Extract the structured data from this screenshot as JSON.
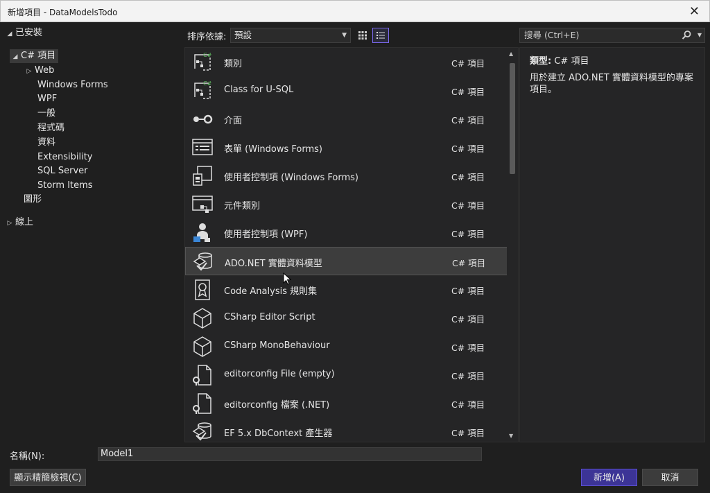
{
  "window": {
    "title": "新增項目 - DataModelsTodo"
  },
  "tree": {
    "installed": "已安裝",
    "csharp": "C# 項目",
    "children": [
      "Web",
      "Windows Forms",
      "WPF",
      "一般",
      "程式碼",
      "資料",
      "Extensibility",
      "SQL Server",
      "Storm Items"
    ],
    "graphics": "圖形",
    "online": "線上"
  },
  "toolbar": {
    "sort_label": "排序依據:",
    "sort_value": "預設"
  },
  "search": {
    "placeholder": "搜尋 (Ctrl+E)"
  },
  "items": [
    {
      "name": "類別",
      "lang": "C# 項目",
      "icon": "class-icon"
    },
    {
      "name": "Class for U-SQL",
      "lang": "C# 項目",
      "icon": "class-icon"
    },
    {
      "name": "介面",
      "lang": "C# 項目",
      "icon": "interface-icon"
    },
    {
      "name": "表單 (Windows Forms)",
      "lang": "C# 項目",
      "icon": "form-icon"
    },
    {
      "name": "使用者控制項 (Windows Forms)",
      "lang": "C# 項目",
      "icon": "user-control-icon"
    },
    {
      "name": "元件類別",
      "lang": "C# 項目",
      "icon": "component-icon"
    },
    {
      "name": "使用者控制項 (WPF)",
      "lang": "C# 項目",
      "icon": "wpf-user-control-icon"
    },
    {
      "name": "ADO.NET 實體資料模型",
      "lang": "C# 項目",
      "icon": "entity-model-icon"
    },
    {
      "name": "Code Analysis 規則集",
      "lang": "C# 項目",
      "icon": "ruleset-icon"
    },
    {
      "name": "CSharp Editor Script",
      "lang": "C# 項目",
      "icon": "cube-icon"
    },
    {
      "name": "CSharp MonoBehaviour",
      "lang": "C# 項目",
      "icon": "cube-icon"
    },
    {
      "name": "editorconfig File (empty)",
      "lang": "C# 項目",
      "icon": "config-file-icon"
    },
    {
      "name": "editorconfig 檔案 (.NET)",
      "lang": "C# 項目",
      "icon": "config-file-icon"
    },
    {
      "name": "EF 5.x DbContext 產生器",
      "lang": "C# 項目",
      "icon": "entity-model-icon"
    }
  ],
  "selected_index": 7,
  "details": {
    "type_label": "類型:",
    "type_value": "C# 項目",
    "description": "用於建立 ADO.NET 實體資料模型的專案項目。"
  },
  "bottom": {
    "name_label": "名稱(N):",
    "name_value": "Model1",
    "compact_view": "顯示精簡檢視(C)",
    "add": "新增(A)",
    "cancel": "取消"
  },
  "colors": {
    "accent": "#3c3496",
    "background": "#1f1f1f",
    "list_bg": "#252526",
    "selected_row": "#3d3d3d"
  }
}
